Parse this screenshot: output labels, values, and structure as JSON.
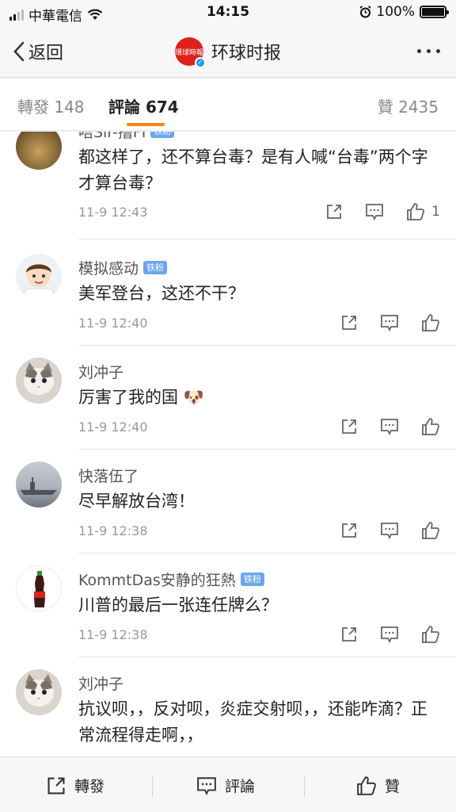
{
  "status": {
    "carrier": "中華電信",
    "time": "14:15",
    "battery": "100%",
    "battery_level": 1.0
  },
  "nav": {
    "back_label": "返回",
    "title": "环球时报",
    "logo_text": "環球時報"
  },
  "tabs": [
    {
      "label": "轉發 148"
    },
    {
      "label": "評論 674"
    },
    {
      "label": "贊 2435"
    }
  ],
  "comments": [
    {
      "author": "唔Sir-撸FI",
      "badge": "铁粉",
      "text": "都这样了，还不算台毒？是有人喊“台毒”两个字才算台毒？",
      "time": "11-9 12:43",
      "likes": "1",
      "avatar": "landscape-avatar"
    },
    {
      "author": "模拟感动",
      "badge": "铁粉",
      "text": "美军登台，这还不干？",
      "time": "11-9 12:40",
      "likes": "",
      "avatar": "cartoon-boy-avatar"
    },
    {
      "author": "刘冲子",
      "badge": "",
      "text": "厉害了我的国 🐶",
      "time": "11-9 12:40",
      "likes": "",
      "avatar": "cat-avatar"
    },
    {
      "author": "快落伍了",
      "badge": "",
      "text": "尽早解放台湾！",
      "time": "11-9 12:38",
      "likes": "",
      "avatar": "ship-avatar"
    },
    {
      "author": "KommtDas安静的狂熱",
      "badge": "铁粉",
      "text": "川普的最后一张连任牌么？",
      "time": "11-9 12:38",
      "likes": "",
      "avatar": "cola-bottle-avatar"
    },
    {
      "author": "刘冲子",
      "badge": "",
      "text": "抗议呗，，反对呗，炎症交射呗，，还能咋滴？正常流程得走啊，，",
      "time": "",
      "likes": "",
      "avatar": "cat-avatar"
    }
  ],
  "bottom": {
    "repost": "轉發",
    "comment": "評論",
    "like": "贊"
  },
  "colors": {
    "accent": "#ff8200",
    "badge": "#6aa6f0",
    "brand_red": "#e0201b"
  }
}
